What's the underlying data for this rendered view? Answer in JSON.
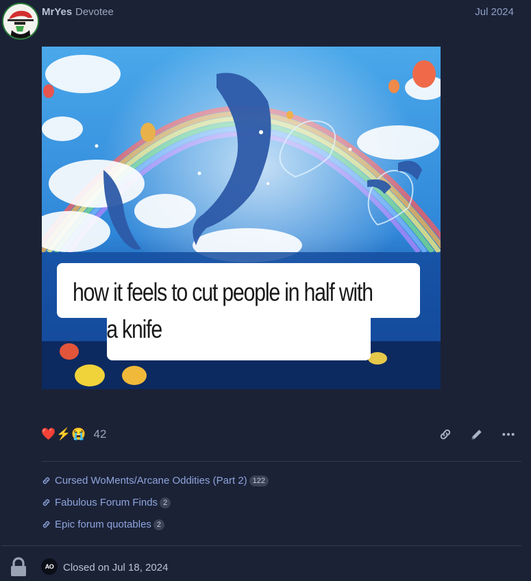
{
  "post": {
    "username": "MrYes",
    "user_title": "Devotee",
    "date": "Jul 2024",
    "image": {
      "caption_line1": "how it feels to cut people in half with",
      "caption_line2": "a knife"
    },
    "reactions": {
      "emojis": [
        "❤️",
        "⚡",
        "😭"
      ],
      "count": "42"
    },
    "actions": {
      "link_icon": "link-icon",
      "edit_icon": "pencil-icon",
      "more_icon": "ellipsis-icon"
    }
  },
  "linked_topics": [
    {
      "title": "Cursed WoMents/Arcane Oddities (Part 2)",
      "count": "122"
    },
    {
      "title": "Fabulous Forum Finds",
      "count": "2"
    },
    {
      "title": "Epic forum quotables",
      "count": "2"
    }
  ],
  "closed": {
    "avatar_initials": "AO",
    "text": "Closed on Jul 18, 2024"
  },
  "colors": {
    "background": "#1b2236",
    "link": "#8fa5dd",
    "heart": "#e0313f"
  }
}
